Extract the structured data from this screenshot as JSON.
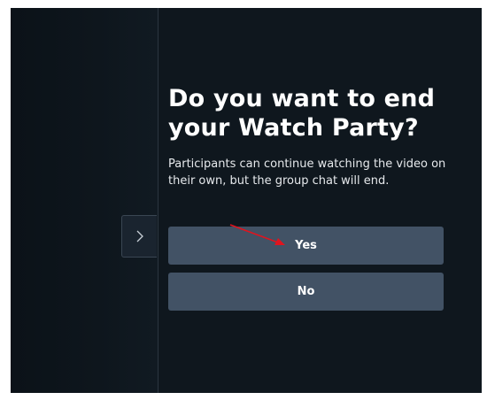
{
  "dialog": {
    "title": "Do you want to end your Watch Party?",
    "message": "Participants can continue watching the video on their own, but the group chat will end.",
    "buttons": {
      "yes_label": "Yes",
      "no_label": "No"
    }
  },
  "sidebar_toggle": {
    "icon": "chevron-right-icon"
  },
  "colors": {
    "background": "#0f171e",
    "button": "#425265",
    "text": "#ffffff",
    "annotation_arrow": "#e0141e"
  }
}
